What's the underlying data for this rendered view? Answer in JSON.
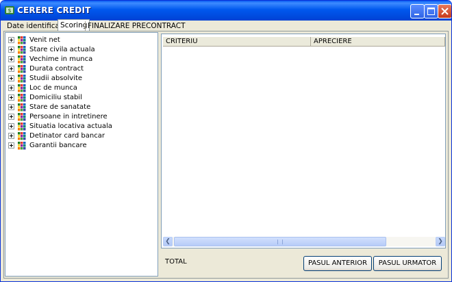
{
  "window": {
    "title": "CERERE CREDIT",
    "icon": "credit-app-icon"
  },
  "titlebar_buttons": [
    {
      "name": "minimize-button",
      "icon": "minimize-icon"
    },
    {
      "name": "maximize-button",
      "icon": "maximize-icon"
    },
    {
      "name": "close-button",
      "icon": "close-icon"
    }
  ],
  "tabs": [
    {
      "label": "Date identificare",
      "active": false
    },
    {
      "label": "Scoring",
      "active": true
    },
    {
      "label": "FINALIZARE PRECONTRACT",
      "active": false
    }
  ],
  "tree": {
    "items": [
      {
        "label": "Venit net"
      },
      {
        "label": "Stare civila actuala"
      },
      {
        "label": "Vechime in munca"
      },
      {
        "label": "Durata contract"
      },
      {
        "label": "Studii absolvite"
      },
      {
        "label": "Loc de munca"
      },
      {
        "label": "Domiciliu stabil"
      },
      {
        "label": "Stare de sanatate"
      },
      {
        "label": "Persoane in intretinere"
      },
      {
        "label": "Situatia locativa actuala"
      },
      {
        "label": "Detinator card bancar"
      },
      {
        "label": "Garantii bancare"
      }
    ],
    "expander_icon": "plus-expand-icon",
    "node_icon": "colored-grid-icon"
  },
  "grid": {
    "columns": [
      "CRITERIU",
      "APRECIERE"
    ],
    "rows": []
  },
  "footer": {
    "total_label": "TOTAL",
    "prev_button": "PASUL ANTERIOR",
    "next_button": "PASUL URMATOR"
  },
  "colors": {
    "titlebar": "#0058ee",
    "window_bg": "#ece9d8",
    "border": "#7f9db9"
  }
}
